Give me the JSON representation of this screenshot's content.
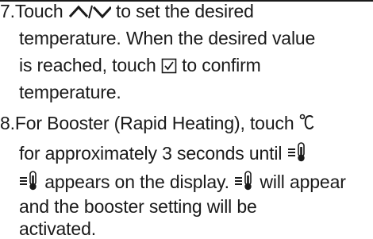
{
  "step7": {
    "number": "7.",
    "line1_a": "Touch",
    "line1_b": "to set the desired",
    "line2": "temperature. When the desired value",
    "line3_a": "is reached, touch",
    "line3_b": "to confirm",
    "line4": "temperature."
  },
  "step8": {
    "number": "8.",
    "line1": "For Booster (Rapid Heating), touch",
    "line2_a": "for approximately 3 seconds until",
    "line3_a": "appears on the display.",
    "line3_b": "will appear",
    "line4": "and the booster setting will be",
    "line5": "activated."
  },
  "icons": {
    "up_down": "up-down-arrows-icon",
    "confirm": "checkbox-confirm-icon",
    "celsius": "celsius-icon",
    "booster": "booster-thermometer-icon"
  }
}
